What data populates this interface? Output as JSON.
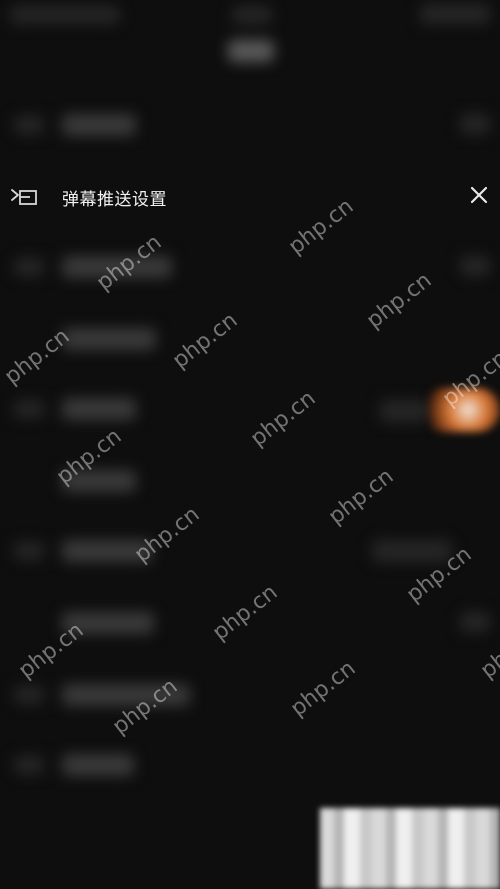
{
  "header": {
    "title": "弹幕推送设置",
    "back_icon": "collapse-menu-icon",
    "close_icon": "close-icon"
  },
  "watermark": {
    "text": "php.cn"
  },
  "colors": {
    "background": "#0e0e0e",
    "accent": "#d97a3a",
    "title_text": "#f2f2f2"
  }
}
